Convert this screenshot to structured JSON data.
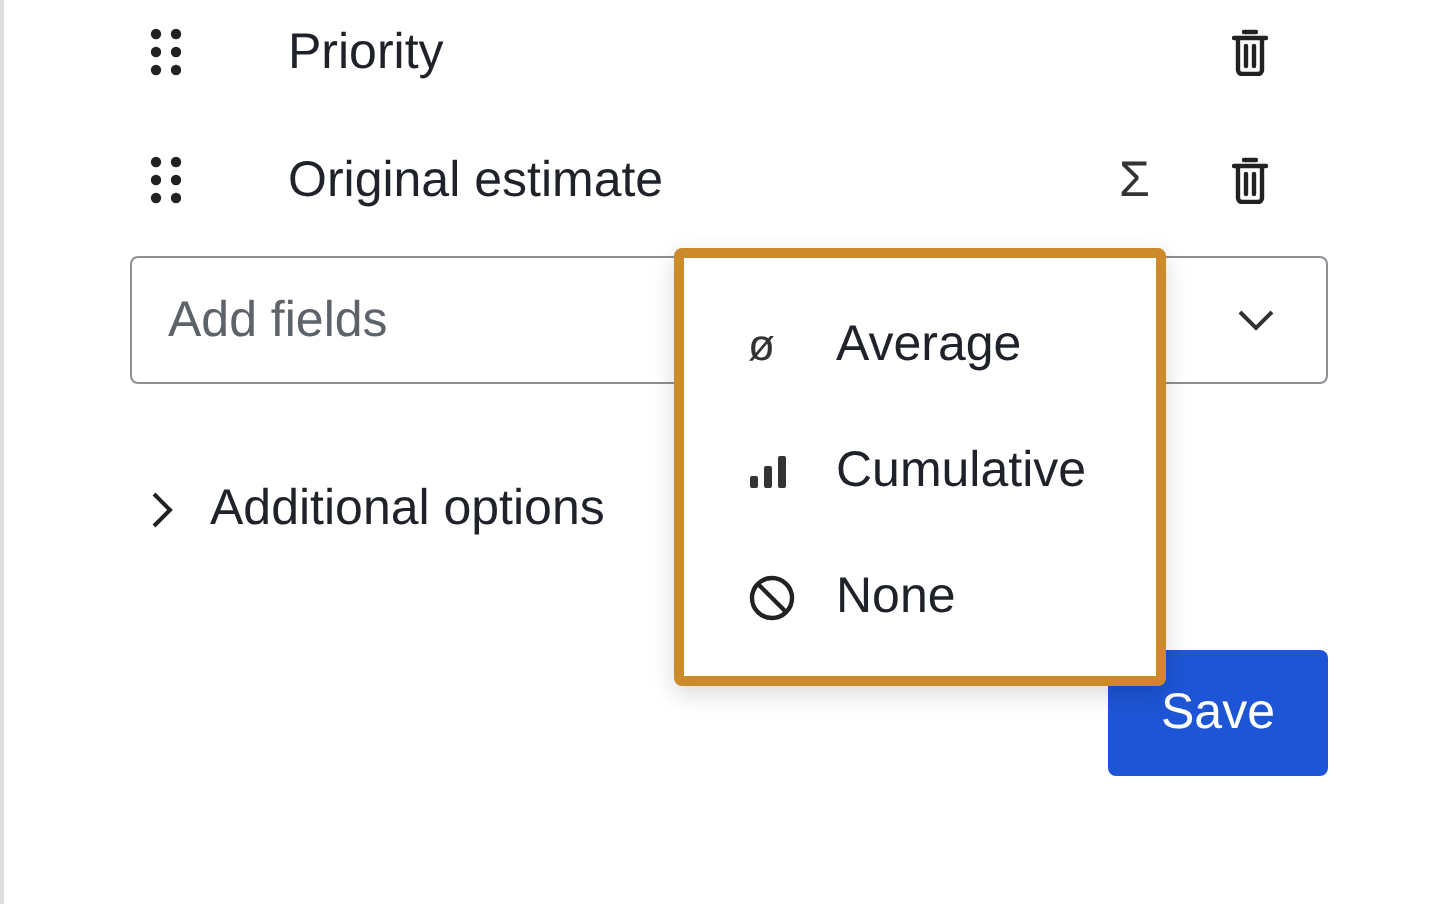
{
  "fields": [
    {
      "label": "Priority"
    },
    {
      "label": "Original estimate",
      "sum_glyph": "Σ"
    }
  ],
  "add_fields": {
    "placeholder": "Add fields"
  },
  "additional_options": {
    "label": "Additional options",
    "expanded": false
  },
  "aggregation_menu": [
    {
      "kind": "glyph",
      "glyph": "ø",
      "label": "Average"
    },
    {
      "kind": "bars",
      "label": "Cumulative"
    },
    {
      "kind": "none",
      "label": "None"
    }
  ],
  "save_button": "Save"
}
